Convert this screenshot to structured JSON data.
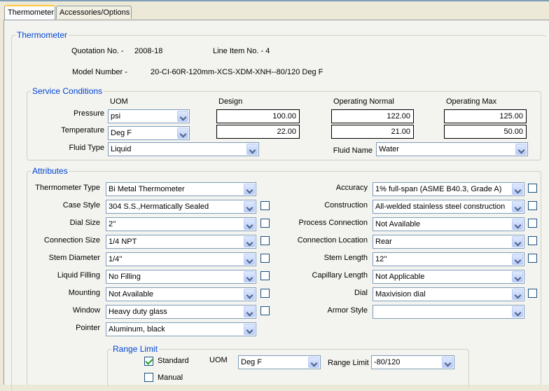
{
  "tabs": [
    "Thermometer",
    "Accessories/Options"
  ],
  "thermometer": {
    "legend": "Thermometer",
    "quotation_label": "Quotation No. -",
    "quotation_value": "2008-18",
    "line_item_label": "Line Item No. - 4",
    "model_label": "Model Number -",
    "model_value": "20-CI-60R-120mm-XCS-XDM-XNH--80/120 Deg F"
  },
  "service": {
    "legend": "Service Conditions",
    "col_uom": "UOM",
    "col_design": "Design",
    "col_op_normal": "Operating Normal",
    "col_op_max": "Operating Max",
    "pressure_label": "Pressure",
    "pressure_uom": "psi",
    "pressure_design": "100.00",
    "pressure_normal": "122.00",
    "pressure_max": "125.00",
    "temperature_label": "Temperature",
    "temperature_uom": "Deg F",
    "temperature_design": "22.00",
    "temperature_normal": "21.00",
    "temperature_max": "50.00",
    "fluid_type_label": "Fluid Type",
    "fluid_type_value": "Liquid",
    "fluid_name_label": "Fluid Name",
    "fluid_name_value": "Water"
  },
  "attributes": {
    "legend": "Attributes",
    "left": [
      {
        "label": "Thermometer Type",
        "value": "Bi Metal Thermometer",
        "checkbox": false
      },
      {
        "label": "Case Style",
        "value": "304 S.S.,Hermatically Sealed",
        "checkbox": true
      },
      {
        "label": "Dial Size",
        "value": "2''",
        "checkbox": true
      },
      {
        "label": "Connection Size",
        "value": "1/4 NPT",
        "checkbox": true
      },
      {
        "label": "Stem Diameter",
        "value": "1/4''",
        "checkbox": true
      },
      {
        "label": "Liquid Filling",
        "value": "No Filling",
        "checkbox": true
      },
      {
        "label": "Mounting",
        "value": "Not Available",
        "checkbox": true
      },
      {
        "label": "Window",
        "value": "Heavy duty glass",
        "checkbox": true
      },
      {
        "label": "Pointer",
        "value": "Aluminum, black",
        "checkbox": false
      }
    ],
    "right": [
      {
        "label": "Accuracy",
        "value": "1% full-span (ASME B40.3, Grade A)",
        "checkbox": true
      },
      {
        "label": "Construction",
        "value": "All-welded stainless steel construction",
        "checkbox": true
      },
      {
        "label": "Process Connection",
        "value": "Not Available",
        "checkbox": true
      },
      {
        "label": "Connection Location",
        "value": "Rear",
        "checkbox": true
      },
      {
        "label": "Stem Length",
        "value": "12''",
        "checkbox": true
      },
      {
        "label": "Capillary Length",
        "value": "Not Applicable",
        "checkbox": false
      },
      {
        "label": "Dial",
        "value": "Maxivision dial",
        "checkbox": true
      },
      {
        "label": "Armor Style",
        "value": "",
        "checkbox": false
      }
    ]
  },
  "range": {
    "legend": "Range Limit",
    "standard_label": "Standard",
    "standard_checked": true,
    "manual_label": "Manual",
    "manual_checked": false,
    "uom_label": "UOM",
    "uom_value": "Deg F",
    "range_label": "Range Limit",
    "range_value": "-80/120"
  }
}
